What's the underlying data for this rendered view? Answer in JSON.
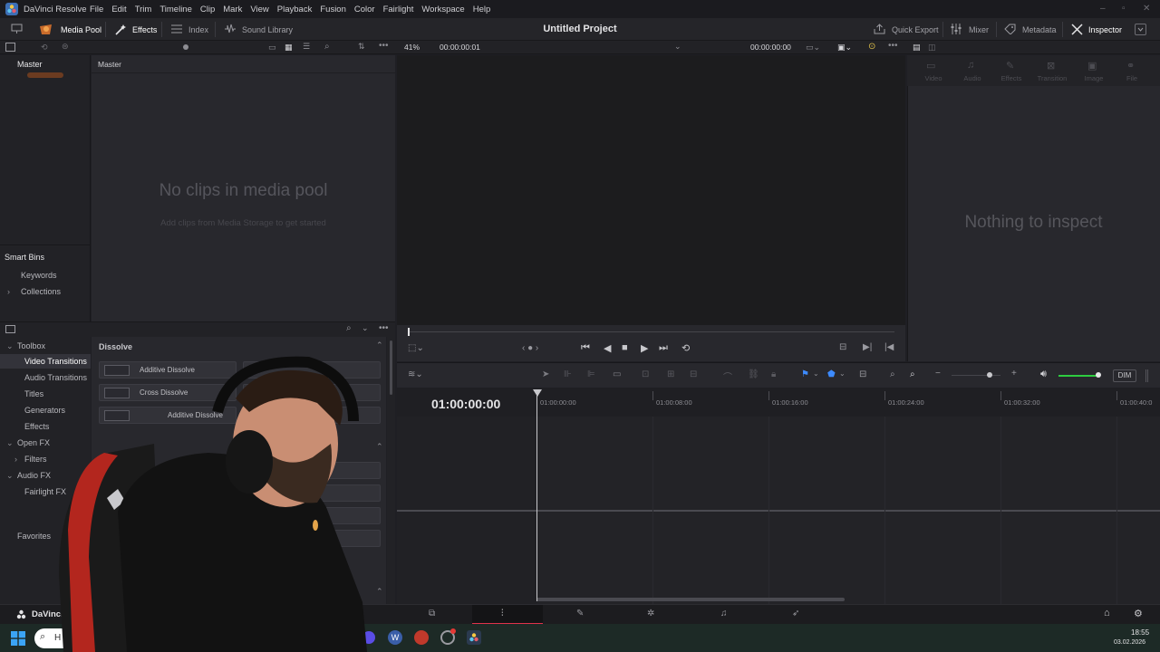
{
  "app": {
    "name": "DaVinci Resolve"
  },
  "menu": [
    "File",
    "Edit",
    "Trim",
    "Timeline",
    "Clip",
    "Mark",
    "View",
    "Playback",
    "Fusion",
    "Color",
    "Fairlight",
    "Workspace",
    "Help"
  ],
  "toolbar": {
    "media_pool": "Media Pool",
    "effects": "Effects",
    "index": "Index",
    "sound_library": "Sound Library",
    "project_title": "Untitled Project",
    "quick_export": "Quick Export",
    "mixer": "Mixer",
    "metadata": "Metadata",
    "inspector": "Inspector"
  },
  "viewer": {
    "zoom": "41%",
    "timecode_left": "00:00:00:01",
    "timecode_right": "00:00:00:00"
  },
  "media_pool": {
    "bin_header": "Master",
    "clips_header": "Master",
    "empty_title": "No clips in media pool",
    "empty_sub": "Add clips from Media Storage to get started",
    "smart_bins": "Smart Bins",
    "smart_items": [
      "Keywords",
      "Collections"
    ]
  },
  "inspector": {
    "tabs": [
      "Video",
      "Audio",
      "Effects",
      "Transition",
      "Image",
      "File"
    ],
    "empty": "Nothing to inspect"
  },
  "effects": {
    "tree": [
      {
        "label": "Toolbox",
        "level": 0,
        "expanded": true
      },
      {
        "label": "Video Transitions",
        "level": 1,
        "selected": true
      },
      {
        "label": "Audio Transitions",
        "level": 1
      },
      {
        "label": "Titles",
        "level": 1
      },
      {
        "label": "Generators",
        "level": 1
      },
      {
        "label": "Effects",
        "level": 1
      },
      {
        "label": "Open FX",
        "level": 0,
        "expanded": true
      },
      {
        "label": "Filters",
        "level": 1,
        "collapsed": true
      },
      {
        "label": "Audio FX",
        "level": 0,
        "expanded": true
      },
      {
        "label": "Fairlight FX",
        "level": 1
      },
      {
        "label": "Favorites",
        "level": 0
      }
    ],
    "section": "Dissolve",
    "tiles": [
      "Additive Dissolve",
      "Cross Dissolve",
      "Additive Dissolve"
    ]
  },
  "timeline": {
    "timecode": "01:00:00:00",
    "ticks": [
      "01:00:00:00",
      "01:00:08:00",
      "01:00:16:00",
      "01:00:24:00",
      "01:00:32:00",
      "01:00:40:0"
    ],
    "dim_label": "DIM"
  },
  "pagebar": {
    "label": "DaVinci R"
  },
  "taskbar": {
    "time": "18:55",
    "date": "03.02.2026",
    "search_char": "H"
  },
  "colors": {
    "accent_blue": "#3d8bff",
    "active_red": "#e0324b",
    "volume_green": "#2ecc40"
  }
}
